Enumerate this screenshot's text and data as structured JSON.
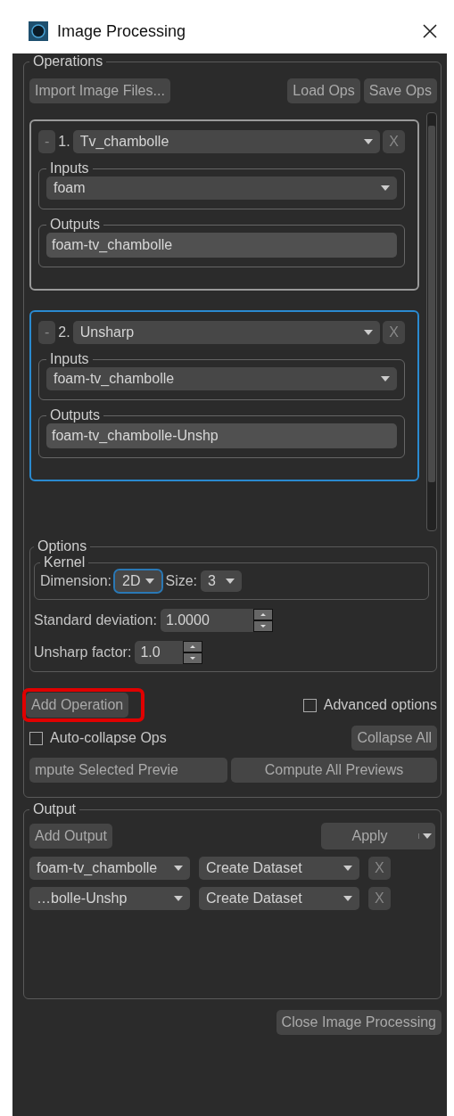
{
  "window": {
    "title": "Image Processing"
  },
  "operations": {
    "label": "Operations",
    "import_button": "Import Image Files...",
    "load_button": "Load Ops",
    "save_button": "Save Ops",
    "items": [
      {
        "collapse": "-",
        "number": "1.",
        "name": "Tv_chambolle",
        "remove": "X",
        "selected": false,
        "inputs_label": "Inputs",
        "input": "foam",
        "outputs_label": "Outputs",
        "output": "foam-tv_chambolle"
      },
      {
        "collapse": "-",
        "number": "2.",
        "name": "Unsharp",
        "remove": "X",
        "selected": true,
        "inputs_label": "Inputs",
        "input": "foam-tv_chambolle",
        "outputs_label": "Outputs",
        "output": "foam-tv_chambolle-Unshp"
      }
    ],
    "options": {
      "label": "Options",
      "kernel": {
        "label": "Kernel",
        "dimension_label": "Dimension:",
        "dimension": "2D",
        "dimension_focused": true,
        "size_label": "Size:",
        "size": "3"
      },
      "standard_deviation": {
        "label": "Standard deviation:",
        "value": "1.0000"
      },
      "unsharp_factor": {
        "label": "Unsharp factor:",
        "value": "1.0"
      }
    },
    "add_operation": {
      "label": "Add Operation",
      "highlighted": true
    },
    "advanced_options": {
      "label": "Advanced options",
      "checked": false
    },
    "auto_collapse": {
      "label": "Auto-collapse Ops",
      "checked": false
    },
    "collapse_all": "Collapse All",
    "compute_selected": "mpute Selected Previe",
    "compute_all": "Compute All Previews"
  },
  "output": {
    "label": "Output",
    "add_output": "Add Output",
    "apply": "Apply",
    "rows": [
      {
        "source": "foam-tv_chambolle",
        "action": "Create Dataset",
        "remove": "X"
      },
      {
        "source": "…bolle-Unshp",
        "action": "Create Dataset",
        "remove": "X"
      }
    ]
  },
  "close_button": "Close Image Processing"
}
